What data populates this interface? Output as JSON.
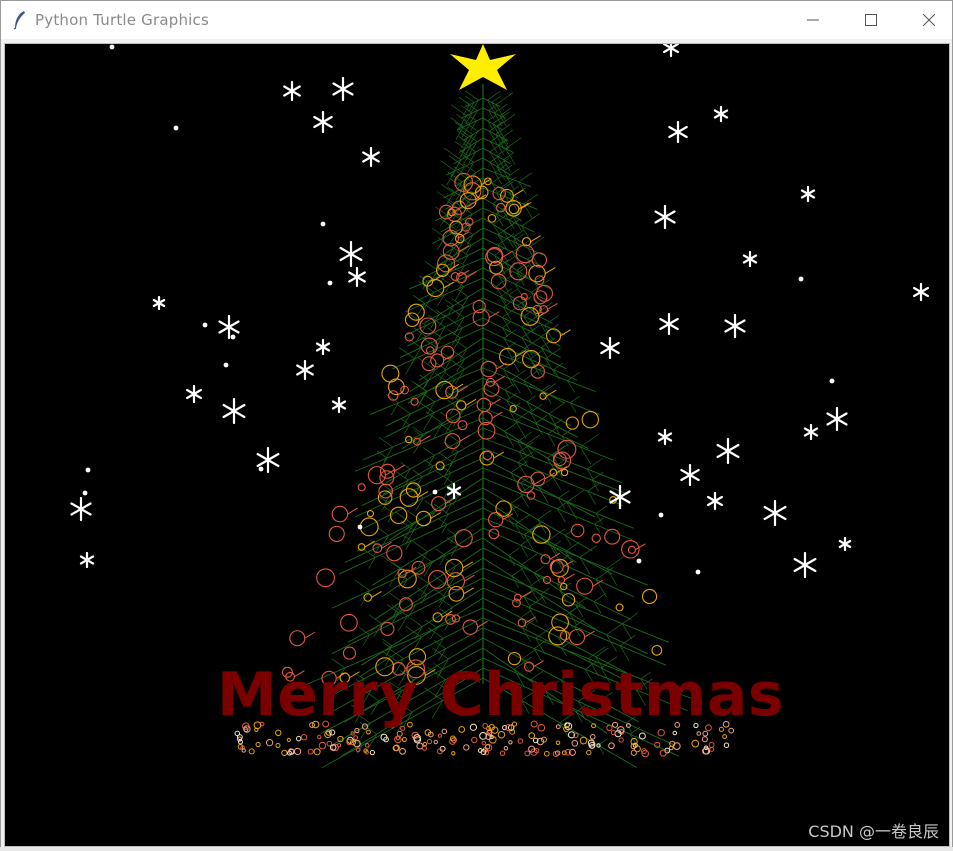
{
  "window": {
    "title": "Python Turtle Graphics",
    "icon": "feather-icon",
    "controls": [
      "minimize-icon",
      "maximize-icon",
      "close-icon"
    ]
  },
  "canvas": {
    "background": "#000000",
    "greeting": "Merry Christmas",
    "greeting_color": "#7a0000",
    "star_color": "#ffee00",
    "tree_color": "#1a6b1a",
    "ornament_colors": [
      "#e4573f",
      "#e8a400"
    ],
    "snow_color": "#ffffff"
  },
  "watermark": "CSDN @一卷良辰"
}
